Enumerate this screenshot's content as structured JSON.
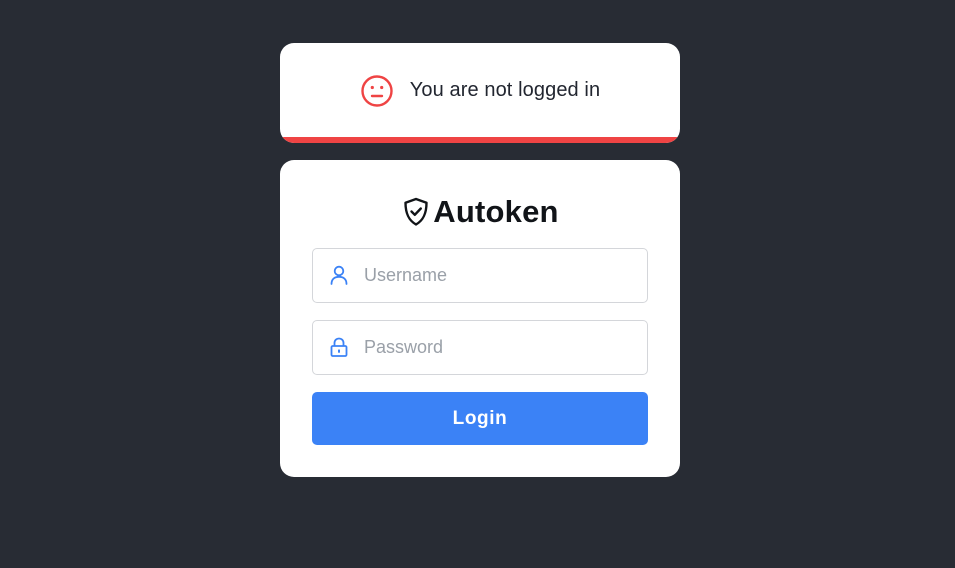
{
  "status": {
    "message": "You are not logged in",
    "icon": "neutral-face-icon",
    "color": "#ef4444"
  },
  "login": {
    "brand_icon": "shield-check-icon",
    "brand_name": "Autoken",
    "username": {
      "icon": "user-icon",
      "placeholder": "Username",
      "value": ""
    },
    "password": {
      "icon": "lock-icon",
      "placeholder": "Password",
      "value": ""
    },
    "submit_label": "Login",
    "accent_color": "#3b82f6"
  },
  "theme": {
    "background": "#282c34",
    "card": "#ffffff"
  }
}
